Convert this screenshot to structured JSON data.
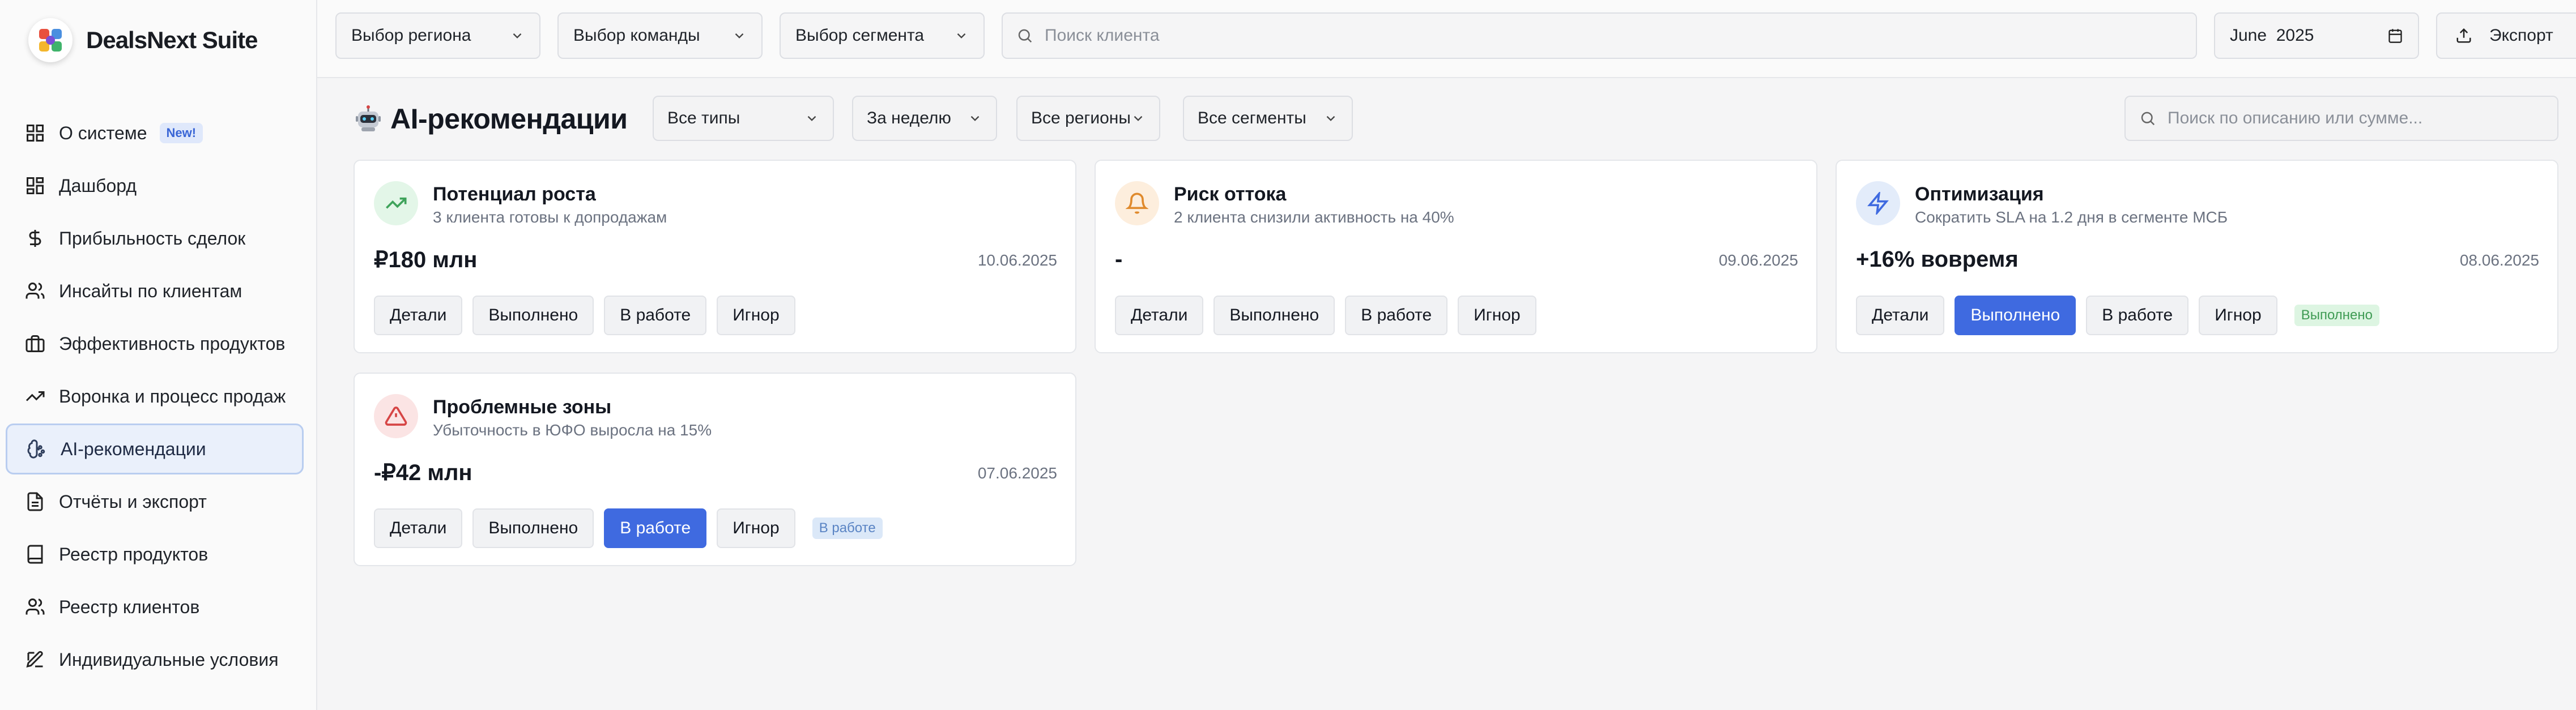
{
  "app": {
    "title": "DealsNext Suite"
  },
  "sidebar": {
    "items": [
      {
        "label": "О системе",
        "badge": "New!",
        "icon": "grid-icon"
      },
      {
        "label": "Дашборд",
        "icon": "dashboard-icon"
      },
      {
        "label": "Прибыльность сделок",
        "icon": "dollar-icon"
      },
      {
        "label": "Инсайты по клиентам",
        "icon": "users-icon"
      },
      {
        "label": "Эффективность продуктов",
        "icon": "briefcase-icon"
      },
      {
        "label": "Воронка и процесс продаж",
        "icon": "trend-icon"
      },
      {
        "label": "AI-рекомендации",
        "icon": "brain-icon",
        "active": true
      },
      {
        "label": "Отчёты и экспорт",
        "icon": "file-icon"
      },
      {
        "label": "Реестр продуктов",
        "icon": "book-icon"
      },
      {
        "label": "Реестр клиентов",
        "icon": "users-icon"
      },
      {
        "label": "Индивидуальные условия",
        "icon": "edit-icon"
      }
    ]
  },
  "topbar": {
    "region": "Выбор региона",
    "team": "Выбор команды",
    "segment": "Выбор сегмента",
    "search_placeholder": "Поиск клиента",
    "date_value": "June  2025",
    "export_label": "Экспорт"
  },
  "main": {
    "title": "AI-рекомендации",
    "filters": {
      "type": "Все типы",
      "period": "За неделю",
      "region": "Все регионы",
      "segment": "Все сегменты"
    },
    "search_placeholder": "Поиск по описанию или сумме...",
    "cards": [
      {
        "title": "Потенциал роста",
        "subtitle": "3 клиента готовы к допродажам",
        "value": "₽180 млн",
        "date": "10.06.2025",
        "icon": "trend-up-icon",
        "icon_bg": "#e3f6e8",
        "icon_color": "#3fa35b",
        "active": "",
        "status": ""
      },
      {
        "title": "Риск оттока",
        "subtitle": "2 клиента снизили активность на 40%",
        "value": "-",
        "date": "09.06.2025",
        "icon": "bell-icon",
        "icon_bg": "#fdeedd",
        "icon_color": "#e08a2c",
        "active": "",
        "status": ""
      },
      {
        "title": "Оптимизация",
        "subtitle": "Сократить SLA на 1.2 дня в сегменте МСБ",
        "value": "+16% вовремя",
        "date": "08.06.2025",
        "icon": "bolt-icon",
        "icon_bg": "#e3ecfa",
        "icon_color": "#3f6ae0",
        "active": "done",
        "status": "Выполнено"
      },
      {
        "title": "Проблемные зоны",
        "subtitle": "Убыточность в ЮФО выросла на 15%",
        "value": "-₽42 млн",
        "date": "07.06.2025",
        "icon": "warning-icon",
        "icon_bg": "#fbe4e4",
        "icon_color": "#d64545",
        "active": "progress",
        "status": "В работе"
      }
    ],
    "actions": {
      "details": "Детали",
      "done": "Выполнено",
      "in_progress": "В работе",
      "ignore": "Игнор"
    }
  }
}
